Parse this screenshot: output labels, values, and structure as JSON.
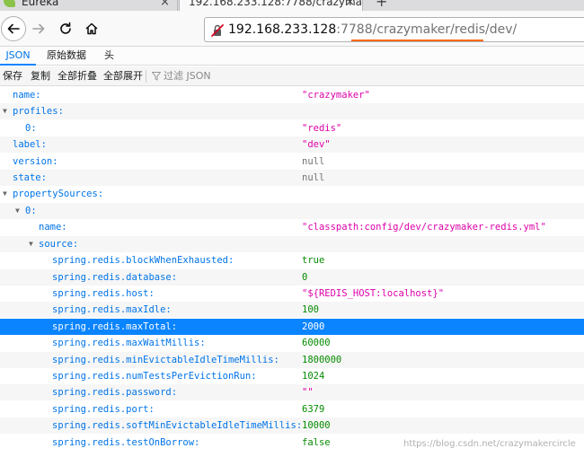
{
  "browser": {
    "tabs": [
      {
        "title": "Eureka",
        "close": "×"
      },
      {
        "title": "192.168.233.128:7788/crazymak",
        "close": "×"
      }
    ],
    "new_tab": "+",
    "url_host": "192.168.233.128",
    "url_rest": ":7788/crazymaker/redis/dev/"
  },
  "viewer": {
    "tabs": [
      "JSON",
      "原始数据",
      "头"
    ],
    "toolbar": {
      "save": "保存",
      "copy": "复制",
      "collapse_all": "全部折叠",
      "expand_all": "全部展开",
      "filter_placeholder": "过滤 JSON"
    }
  },
  "json_tree": [
    {
      "key": "name:",
      "value": "\"crazymaker\"",
      "type": "str"
    },
    {
      "key": "profiles:",
      "value": "",
      "type": "obj",
      "expanded": true
    },
    {
      "key": "0:",
      "value": "\"redis\"",
      "type": "str"
    },
    {
      "key": "label:",
      "value": "\"dev\"",
      "type": "str"
    },
    {
      "key": "version:",
      "value": "null",
      "type": "null"
    },
    {
      "key": "state:",
      "value": "null",
      "type": "null"
    },
    {
      "key": "propertySources:",
      "value": "",
      "type": "obj",
      "expanded": true
    },
    {
      "key": "0:",
      "value": "",
      "type": "obj",
      "expanded": true
    },
    {
      "key": "name:",
      "value": "\"classpath:config/dev/crazymaker-redis.yml\"",
      "type": "str"
    },
    {
      "key": "source:",
      "value": "",
      "type": "obj",
      "expanded": true
    },
    {
      "key": "spring.redis.blockWhenExhausted:",
      "value": "true",
      "type": "bool"
    },
    {
      "key": "spring.redis.database:",
      "value": "0",
      "type": "num"
    },
    {
      "key": "spring.redis.host:",
      "value": "\"${REDIS_HOST:localhost}\"",
      "type": "str"
    },
    {
      "key": "spring.redis.maxIdle:",
      "value": "100",
      "type": "num"
    },
    {
      "key": "spring.redis.maxTotal:",
      "value": "2000",
      "type": "num",
      "selected": true
    },
    {
      "key": "spring.redis.maxWaitMillis:",
      "value": "60000",
      "type": "num"
    },
    {
      "key": "spring.redis.minEvictableIdleTimeMillis:",
      "value": "1800000",
      "type": "num"
    },
    {
      "key": "spring.redis.numTestsPerEvictionRun:",
      "value": "1024",
      "type": "num"
    },
    {
      "key": "spring.redis.password:",
      "value": "\"\"",
      "type": "str"
    },
    {
      "key": "spring.redis.port:",
      "value": "6379",
      "type": "num"
    },
    {
      "key": "spring.redis.softMinEvictableIdleTimeMillis:",
      "value": "10000",
      "type": "num"
    },
    {
      "key": "spring.redis.testOnBorrow:",
      "value": "false",
      "type": "bool"
    }
  ],
  "watermark": "https://blog.csdn.net/crazymakercircle",
  "colors": {
    "key": "#0074e8",
    "string": "#dd00a9",
    "number": "#058b00",
    "null": "#737373",
    "selected_row": "#0a84ff"
  }
}
